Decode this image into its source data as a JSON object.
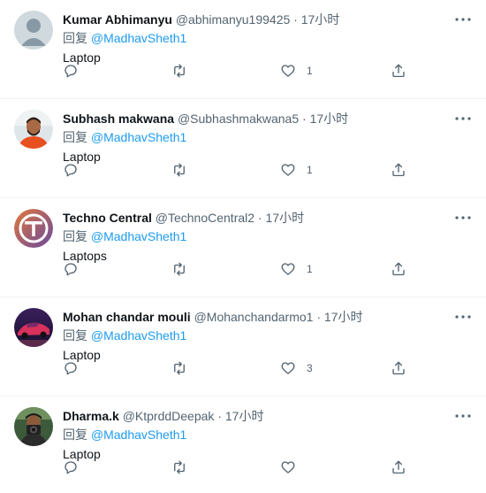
{
  "tweets": [
    {
      "name": "Kumar Abhimanyu",
      "handle": "@abhimanyu199425",
      "separator": "·",
      "time": "17小时",
      "reply_prefix": "回复",
      "mention": "@MadhavSheth1",
      "text": "Laptop",
      "like_count": "1",
      "avatar": "default-avatar"
    },
    {
      "name": "Subhash makwana",
      "handle": "@Subhashmakwana5",
      "separator": "·",
      "time": "17小时",
      "reply_prefix": "回复",
      "mention": "@MadhavSheth1",
      "text": "Laptop",
      "like_count": "1",
      "avatar": "person-photo"
    },
    {
      "name": "Techno Central",
      "handle": "@TechnoCentral2",
      "separator": "·",
      "time": "17小时",
      "reply_prefix": "回复",
      "mention": "@MadhavSheth1",
      "text": "Laptops",
      "like_count": "1",
      "avatar": "tc-logo"
    },
    {
      "name": "Mohan chandar mouli",
      "handle": "@Mohanchandarmo1",
      "separator": "·",
      "time": "17小时",
      "reply_prefix": "回复",
      "mention": "@MadhavSheth1",
      "text": "Laptop",
      "like_count": "3",
      "avatar": "car-photo"
    },
    {
      "name": "Dharma.k",
      "handle": "@KtprddDeepak",
      "separator": "·",
      "time": "17小时",
      "reply_prefix": "回复",
      "mention": "@MadhavSheth1",
      "text": "Laptop",
      "like_count": "",
      "avatar": "camera-person-photo"
    }
  ],
  "icons": {
    "reply": "reply-icon",
    "retweet": "retweet-icon",
    "like": "heart-icon",
    "share": "share-icon",
    "more": "more-icon"
  },
  "colors": {
    "name": "#0f1419",
    "secondary": "#536471",
    "mention": "#1d9bf0",
    "divider": "#eff3f4"
  }
}
